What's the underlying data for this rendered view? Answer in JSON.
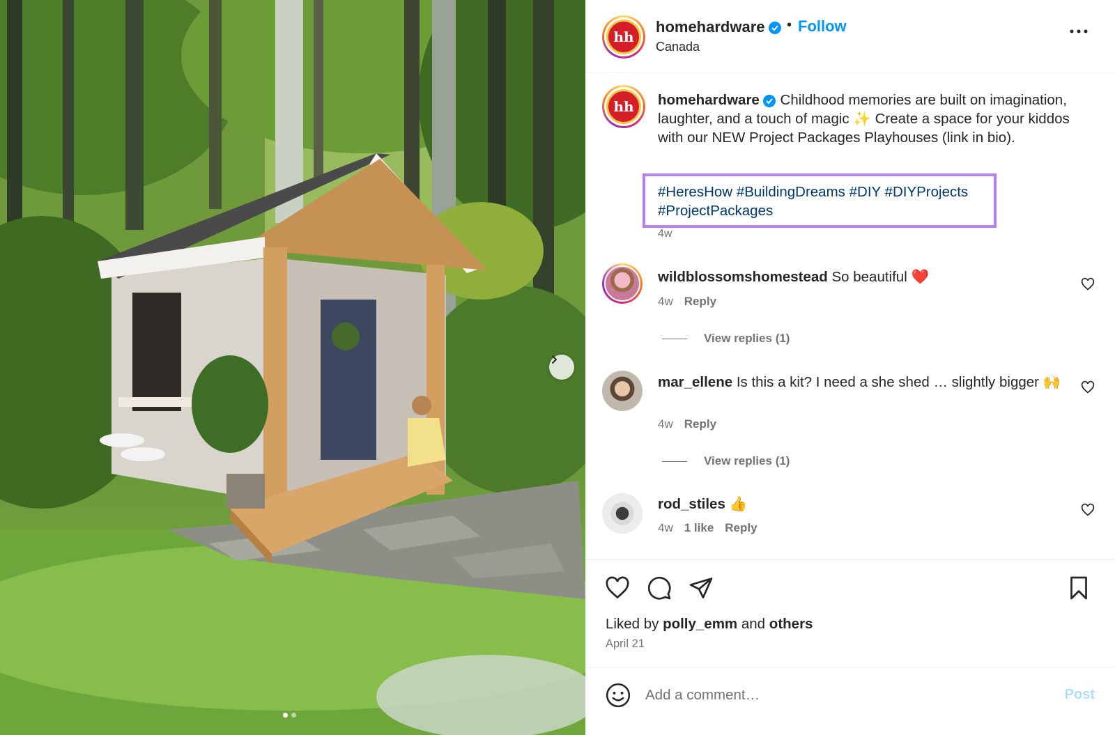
{
  "post": {
    "username": "homehardware",
    "verified": true,
    "separator": "•",
    "follow_label": "Follow",
    "location": "Canada",
    "logo_text": "hh",
    "caption": {
      "username": "homehardware",
      "text": "Childhood memories are built on imagination, laughter, and a touch of magic ✨ Create a space for your kiddos with our NEW Project Packages Playhouses (link in bio).",
      "hashtags": [
        "#HeresHow",
        "#BuildingDreams",
        "#DIY",
        "#DIYProjects",
        "#ProjectPackages"
      ],
      "time": "4w"
    },
    "highlight_color": "#b680f0",
    "carousel": {
      "slides": 2,
      "active": 0
    }
  },
  "comments": [
    {
      "username": "wildblossomshomestead",
      "text": "So beautiful ❤️",
      "time": "4w",
      "likes": "",
      "reply_label": "Reply",
      "view_replies": "View replies (1)"
    },
    {
      "username": "mar_ellene",
      "text": "Is this a kit? I need a she shed … slightly bigger 🙌",
      "time": "4w",
      "likes": "",
      "reply_label": "Reply",
      "view_replies": "View replies (1)"
    },
    {
      "username": "rod_stiles",
      "text": "👍",
      "time": "4w",
      "likes": "1 like",
      "reply_label": "Reply",
      "view_replies": ""
    }
  ],
  "footer": {
    "liked_prefix": "Liked by",
    "liked_user": "polly_emm",
    "liked_and": "and",
    "liked_others": "others",
    "date": "April 21",
    "comment_placeholder": "Add a comment…",
    "post_label": "Post"
  },
  "colors": {
    "link": "#0095f6",
    "hashtag": "#00376b",
    "brand_red": "#d41f2a",
    "muted": "#737373"
  },
  "icons": [
    "verified-badge-icon",
    "more-icon",
    "heart-icon",
    "comment-icon",
    "share-icon",
    "bookmark-icon",
    "emoji-icon",
    "chevron-right-icon"
  ]
}
